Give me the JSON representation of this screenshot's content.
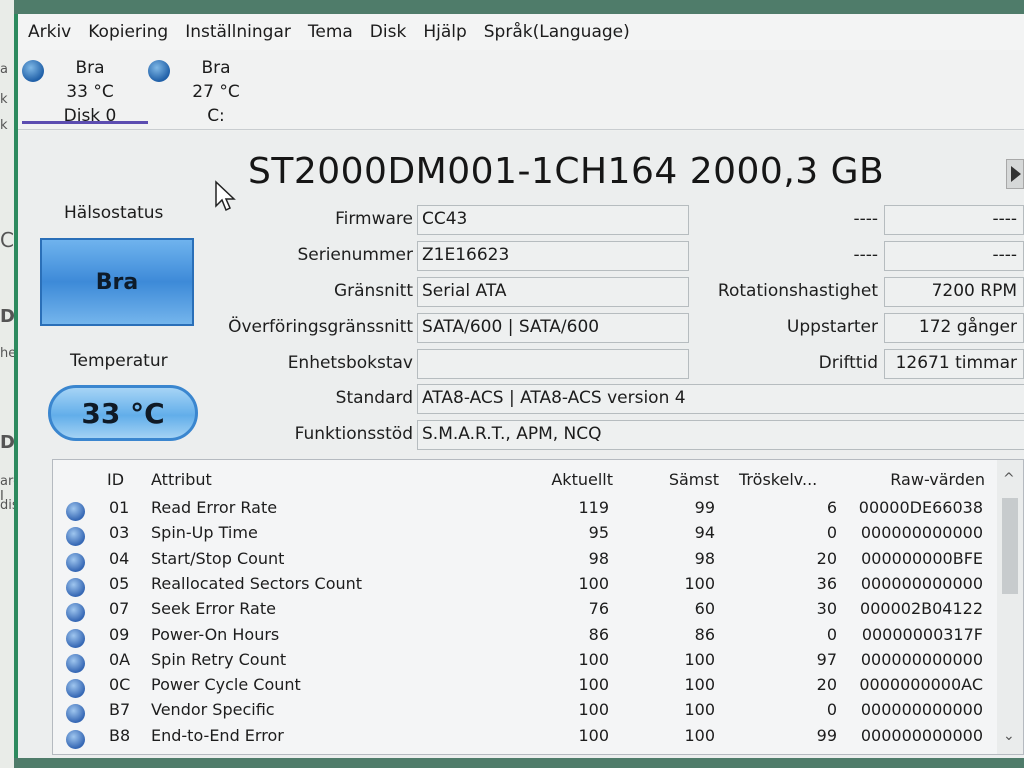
{
  "menu": [
    "Arkiv",
    "Kopiering",
    "Inställningar",
    "Tema",
    "Disk",
    "Hjälp",
    "Språk(Language)"
  ],
  "disks": [
    {
      "status": "Bra",
      "temp": "33 °C",
      "name": "Disk 0"
    },
    {
      "status": "Bra",
      "temp": "27 °C",
      "name": "C:"
    }
  ],
  "model_title": "ST2000DM001-1CH164 2000,3 GB",
  "health": {
    "label": "Hälsostatus",
    "value": "Bra"
  },
  "temperature": {
    "label": "Temperatur",
    "value": "33 °C"
  },
  "fields_left": [
    {
      "label": "Firmware",
      "value": "CC43"
    },
    {
      "label": "Serienummer",
      "value": "Z1E16623"
    },
    {
      "label": "Gränsnitt",
      "value": "Serial ATA"
    },
    {
      "label": "Överföringsgränssnitt",
      "value": "SATA/600 | SATA/600"
    },
    {
      "label": "Enhetsbokstav",
      "value": ""
    }
  ],
  "fields_wide": [
    {
      "label": "Standard",
      "value": "ATA8-ACS | ATA8-ACS version 4"
    },
    {
      "label": "Funktionsstöd",
      "value": "S.M.A.R.T., APM, NCQ"
    }
  ],
  "fields_right": [
    {
      "label": "----",
      "value": "----"
    },
    {
      "label": "----",
      "value": "----"
    },
    {
      "label": "Rotationshastighet",
      "value": "7200 RPM"
    },
    {
      "label": "Uppstarter",
      "value": "172 gånger"
    },
    {
      "label": "Drifttid",
      "value": "12671 timmar"
    }
  ],
  "smart": {
    "headers": {
      "id": "ID",
      "attr": "Attribut",
      "current": "Aktuellt",
      "worst": "Sämst",
      "threshold": "Tröskelv...",
      "raw": "Raw-värden"
    },
    "rows": [
      {
        "id": "01",
        "attr": "Read Error Rate",
        "current": "119",
        "worst": "99",
        "threshold": "6",
        "raw": "00000DE66038"
      },
      {
        "id": "03",
        "attr": "Spin-Up Time",
        "current": "95",
        "worst": "94",
        "threshold": "0",
        "raw": "000000000000"
      },
      {
        "id": "04",
        "attr": "Start/Stop Count",
        "current": "98",
        "worst": "98",
        "threshold": "20",
        "raw": "000000000BFE"
      },
      {
        "id": "05",
        "attr": "Reallocated Sectors Count",
        "current": "100",
        "worst": "100",
        "threshold": "36",
        "raw": "000000000000"
      },
      {
        "id": "07",
        "attr": "Seek Error Rate",
        "current": "76",
        "worst": "60",
        "threshold": "30",
        "raw": "000002B04122"
      },
      {
        "id": "09",
        "attr": "Power-On Hours",
        "current": "86",
        "worst": "86",
        "threshold": "0",
        "raw": "00000000317F"
      },
      {
        "id": "0A",
        "attr": "Spin Retry Count",
        "current": "100",
        "worst": "100",
        "threshold": "97",
        "raw": "000000000000"
      },
      {
        "id": "0C",
        "attr": "Power Cycle Count",
        "current": "100",
        "worst": "100",
        "threshold": "20",
        "raw": "0000000000AC"
      },
      {
        "id": "B7",
        "attr": "Vendor Specific",
        "current": "100",
        "worst": "100",
        "threshold": "0",
        "raw": "000000000000"
      },
      {
        "id": "B8",
        "attr": "End-to-End Error",
        "current": "100",
        "worst": "100",
        "threshold": "99",
        "raw": "000000000000"
      }
    ]
  },
  "left_strip_text": [
    "a",
    "k",
    "C",
    "Di",
    "he",
    "Di",
    "ard I",
    "dis"
  ]
}
